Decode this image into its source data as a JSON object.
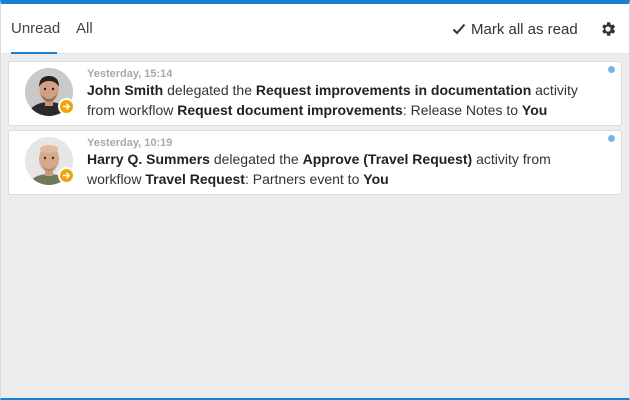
{
  "tabs": {
    "unread": "Unread",
    "all": "All"
  },
  "toolbar": {
    "mark_all": "Mark all as read",
    "settings_icon": "gear-icon"
  },
  "colors": {
    "accent": "#1a7fd0",
    "badge": "#f0a30a",
    "unread_dot": "#6fb8e6"
  },
  "notifications": [
    {
      "time": "Yesterday, 15:14",
      "user": "John Smith",
      "t1": " delegated the ",
      "activity": "Request improvements in documentation",
      "t2": " activity from workflow ",
      "workflow": "Request document improvements",
      "t3": ": Release Notes to ",
      "target": "You",
      "unread": true
    },
    {
      "time": "Yesterday, 10:19",
      "user": "Harry Q. Summers",
      "t1": " delegated the ",
      "activity": "Approve (Travel Request)",
      "t2": " activity from workflow ",
      "workflow": "Travel Request",
      "t3": ": Partners event to ",
      "target": "You",
      "unread": true
    }
  ]
}
